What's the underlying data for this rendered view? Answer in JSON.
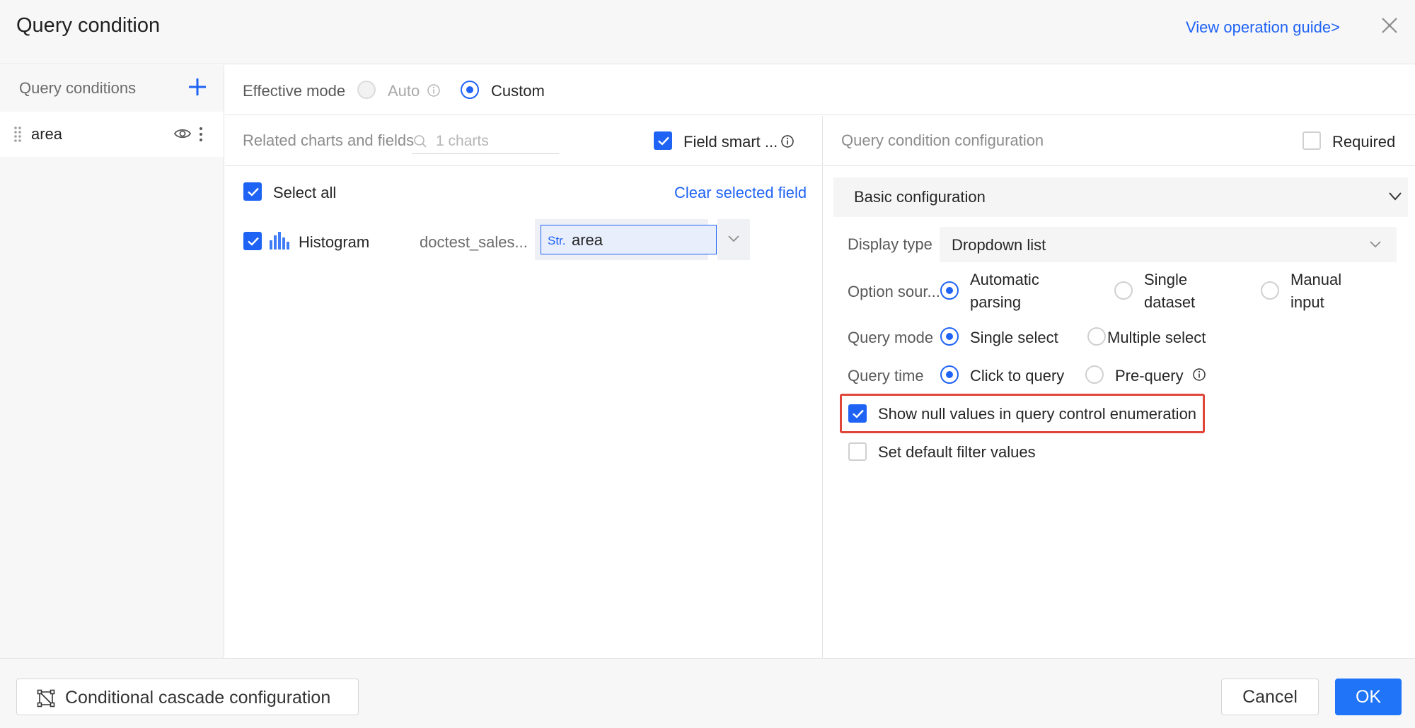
{
  "header": {
    "title": "Query condition",
    "guide_link": "View operation guide>"
  },
  "sidebar": {
    "heading": "Query conditions",
    "items": [
      {
        "label": "area"
      }
    ]
  },
  "effective_mode": {
    "label": "Effective mode",
    "options": [
      {
        "label": "Auto",
        "selected": false,
        "disabled": true
      },
      {
        "label": "Custom",
        "selected": true,
        "disabled": false
      }
    ]
  },
  "related": {
    "heading": "Related charts and fields",
    "search_placeholder": "1 charts",
    "smart_label": "Field smart ...",
    "smart_checked": true,
    "select_all_label": "Select all",
    "clear_label": "Clear selected field",
    "rows": [
      {
        "chart": "Histogram",
        "dataset": "doctest_sales...",
        "field_type": "Str.",
        "field": "area",
        "checked": true
      }
    ]
  },
  "config": {
    "heading": "Query condition configuration",
    "required_label": "Required",
    "section": "Basic configuration",
    "display_type": {
      "label": "Display type",
      "value": "Dropdown list"
    },
    "option_source": {
      "label": "Option sour...",
      "options": [
        {
          "line1": "Automatic",
          "line2": "parsing",
          "selected": true
        },
        {
          "line1": "Single",
          "line2": "dataset",
          "selected": false
        },
        {
          "line1": "Manual",
          "line2": "input",
          "selected": false
        }
      ]
    },
    "query_mode": {
      "label": "Query mode",
      "options": [
        {
          "label": "Single select",
          "selected": true
        },
        {
          "label": "Multiple select",
          "selected": false
        }
      ]
    },
    "query_time": {
      "label": "Query time",
      "options": [
        {
          "label": "Click to query",
          "selected": true
        },
        {
          "label": "Pre-query",
          "selected": false
        }
      ]
    },
    "show_null_label": "Show null values in query control enumeration",
    "show_null_checked": true,
    "default_filter_label": "Set default filter values",
    "default_filter_checked": false
  },
  "footer": {
    "cascade_label": "Conditional cascade configuration",
    "cancel_label": "Cancel",
    "ok_label": "OK"
  },
  "colors": {
    "accent": "#1f63f5",
    "highlight": "#e0453a"
  }
}
